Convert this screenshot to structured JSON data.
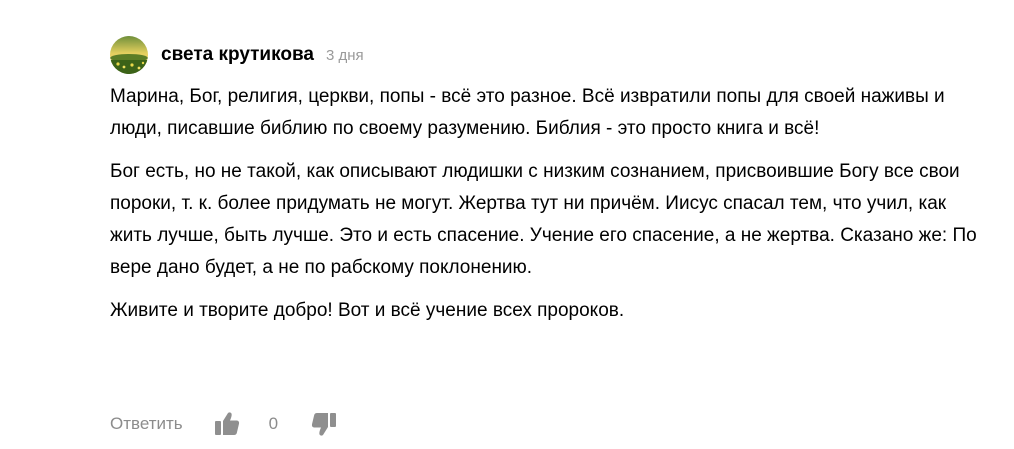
{
  "comment": {
    "author": "света крутикова",
    "time": "3 дня",
    "paragraphs": [
      "Марина, Бог, религия, церкви, попы - всё это разное. Всё извратили попы для своей наживы и люди, писавшие библию по своему разумению. Библия - это просто книга и всё!",
      "Бог есть, но не такой, как описывают людишки с низким сознанием, присвоившие Богу все свои пороки, т. к. более придумать не могут. Жертва тут ни причём. Иисус спасал тем, что учил, как жить лучше, быть лучше. Это и есть спасение. Учение его спасение, а не жертва. Сказано же: По вере дано будет, а не по рабскому поклонению.",
      "Живите и творите добро! Вот и всё учение всех пророков."
    ],
    "actions": {
      "reply_label": "Ответить",
      "like_count": "0",
      "like_icon": "thumbs-up-icon",
      "dislike_icon": "thumbs-down-icon"
    },
    "colors": {
      "muted": "#8c8c8c",
      "icon": "#8f8f8f"
    }
  }
}
